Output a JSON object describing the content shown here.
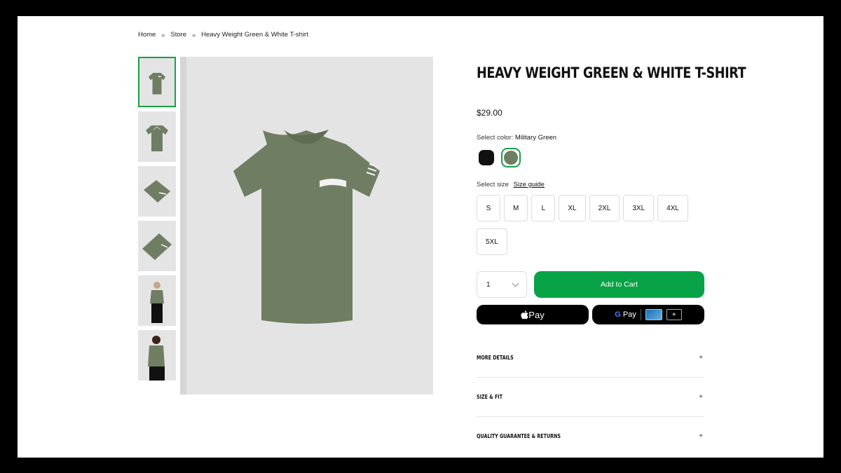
{
  "breadcrumb": {
    "items": [
      "Home",
      "Store",
      "Heavy Weight Green & White T-shirt"
    ],
    "separator": "»"
  },
  "product": {
    "title": "Heavy Weight Green & White T-shirt",
    "price": "$29.00",
    "color_label": "Select color:",
    "selected_color": "Military Green",
    "colors": [
      {
        "name": "Black",
        "hex": "#111111"
      },
      {
        "name": "Military Green",
        "hex": "#6f7e62"
      }
    ],
    "size_label": "Select size",
    "size_guide": "Size guide",
    "sizes": [
      "S",
      "M",
      "L",
      "XL",
      "2XL",
      "3XL",
      "4XL",
      "5XL"
    ],
    "quantity": "1",
    "add_to_cart": "Add to Cart",
    "apple_pay": " Pay",
    "google_pay": "Pay",
    "google_pay_g": "G"
  },
  "accordion": [
    "More Details",
    "Size & Fit",
    "Quality Guarantee & Returns"
  ],
  "theme": {
    "accent": "#07a346",
    "shirt": "#6f7e62",
    "background": "#e4e4e4"
  },
  "icons": {
    "chevron": "chevron-down-icon",
    "plus": "plus-icon",
    "apple": "apple-logo-icon",
    "card": "card-icon"
  }
}
